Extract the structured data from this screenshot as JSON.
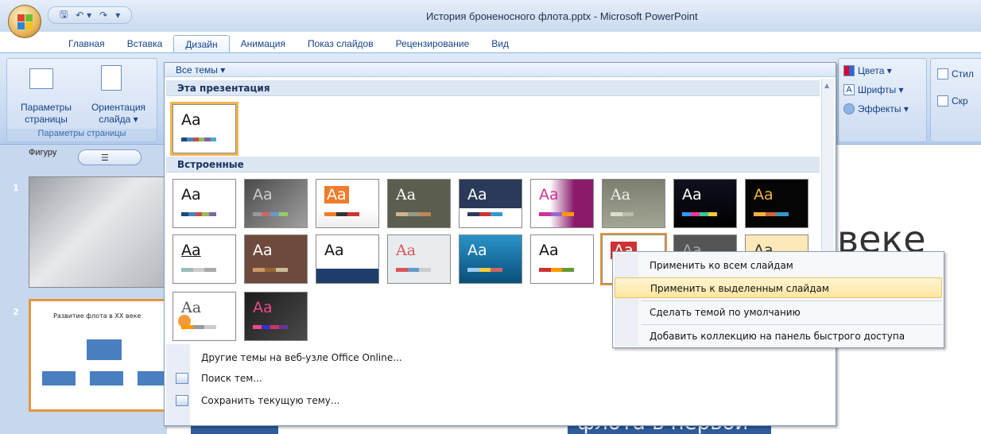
{
  "window": {
    "title": "История броненосного флота.pptx - Microsoft PowerPoint"
  },
  "qat": {
    "icons": [
      "save-icon",
      "undo-icon",
      "redo-icon",
      "customize-icon"
    ],
    "save": "🖫",
    "undo": "↶ ▾",
    "redo": "↷",
    "more": "▾"
  },
  "tabs": [
    "Главная",
    "Вставка",
    "Дизайн",
    "Анимация",
    "Показ слайдов",
    "Рецензирование",
    "Вид"
  ],
  "active_tab": "Дизайн",
  "ribbon": {
    "page_setup_label": "Параметры страницы",
    "orientation_label": "Ориентация слайда ▾",
    "group_label": "Параметры страницы",
    "colors": "Цвета ▾",
    "fonts": "Шрифты ▾",
    "effects": "Эффекты ▾",
    "styles": "Стил",
    "hide": "Скр"
  },
  "left_panel": {
    "tab_label": "Фигуру",
    "slide1_number": "1",
    "slide2_number": "2",
    "slide2_title": "Развитие флота в XX веке"
  },
  "slide": {
    "big_text": "веке",
    "bottom_text": "флота в первой"
  },
  "themes_dropdown": {
    "header": "Все темы ▾",
    "section_this": "Эта презентация",
    "section_builtin": "Встроенные",
    "theme_text": "Aa",
    "more_online": "Другие темы на веб-узле Office Online...",
    "search": "Поиск тем...",
    "save_current": "Сохранить текущую тему..."
  },
  "context_menu": {
    "items": [
      "Применить ко всем слайдам",
      "Применить к выделенным слайдам",
      "Сделать темой по умолчанию",
      "Добавить коллекцию на панель быстрого доступа"
    ],
    "highlighted_index": 1
  }
}
